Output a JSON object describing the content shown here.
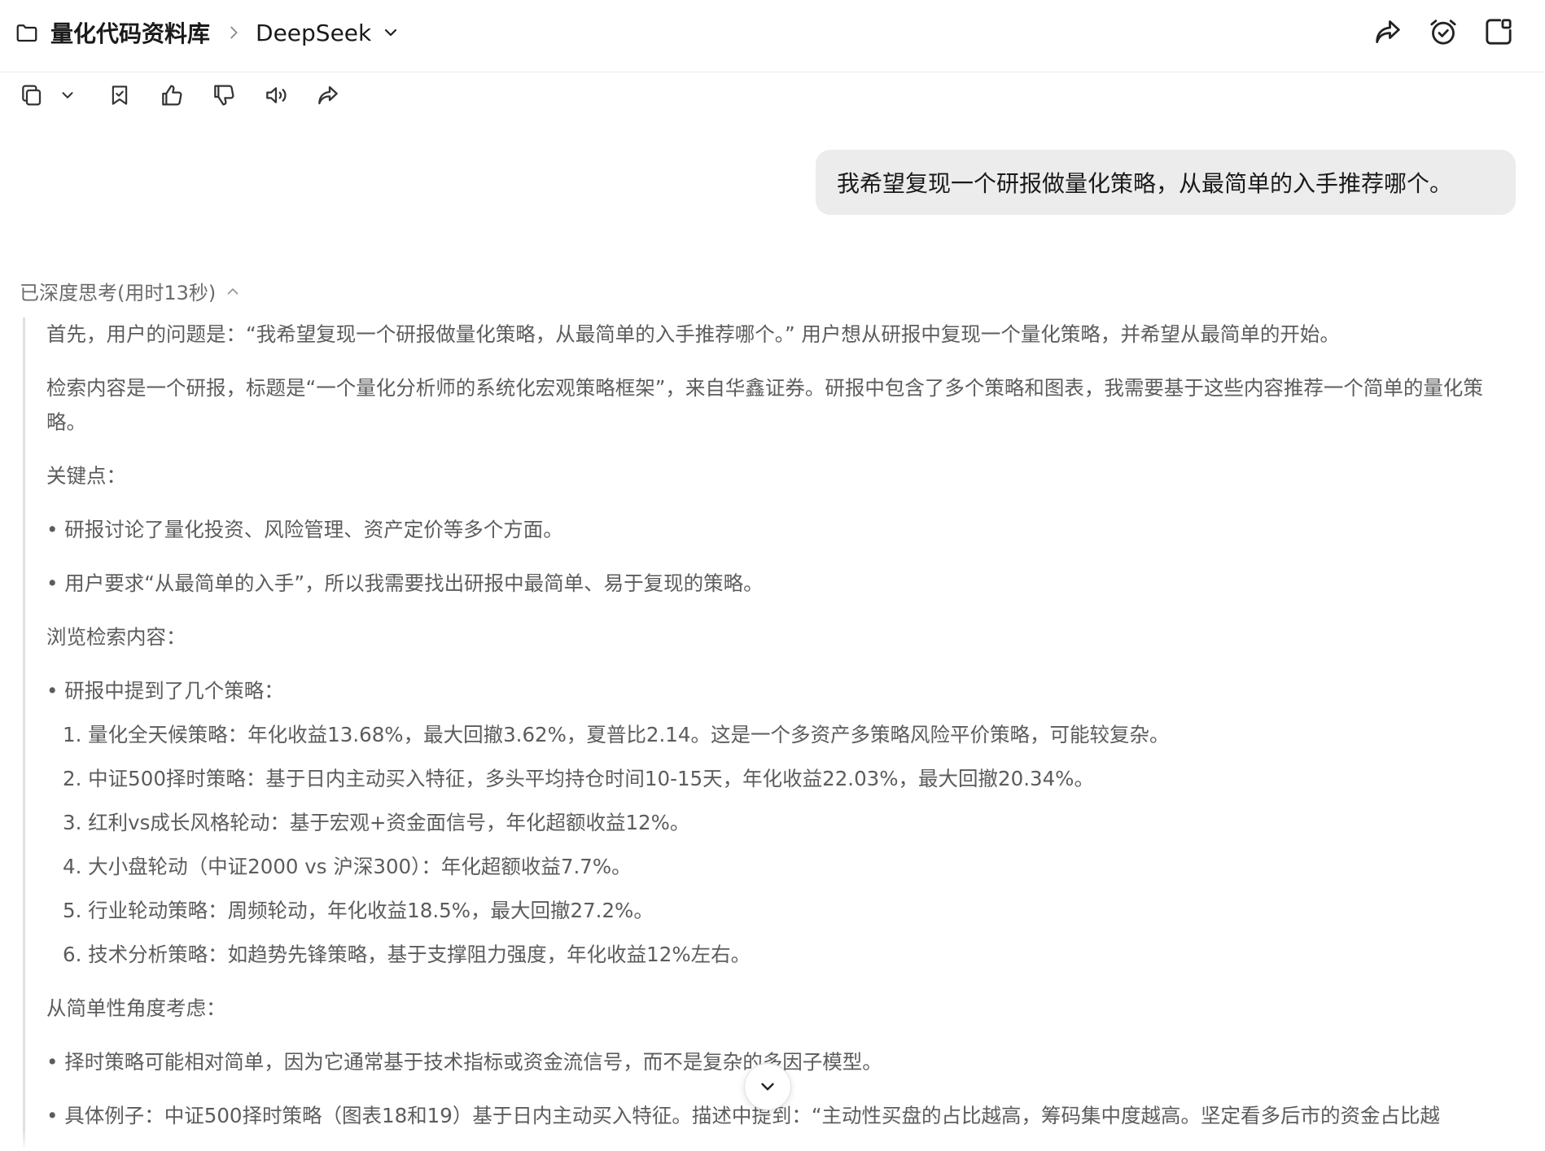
{
  "header": {
    "library": "量化代码资料库",
    "model": "DeepSeek",
    "icons": [
      "folder-icon",
      "chevron-right-icon",
      "chevron-down-icon",
      "share-icon",
      "alarm-check-icon",
      "new-window-icon"
    ]
  },
  "message_actions": {
    "icons": [
      "copy-icon",
      "chevron-down-icon",
      "bookmark-icon",
      "thumbs-up-icon",
      "thumbs-down-icon",
      "speaker-icon",
      "share-icon"
    ]
  },
  "user_message": "我希望复现一个研报做量化策略，从最简单的入手推荐哪个。",
  "thinking": {
    "header": "已深度思考(用时13秒)",
    "p1": "首先，用户的问题是：“我希望复现一个研报做量化策略，从最简单的入手推荐哪个。” 用户想从研报中复现一个量化策略，并希望从最简单的开始。",
    "p2": "检索内容是一个研报，标题是“一个量化分析师的系统化宏观策略框架”，来自华鑫证券。研报中包含了多个策略和图表，我需要基于这些内容推荐一个简单的量化策略。",
    "key_label": "关键点：",
    "key_points": [
      "• 研报讨论了量化投资、风险管理、资产定价等多个方面。",
      "• 用户要求“从最简单的入手”，所以我需要找出研报中最简单、易于复现的策略。"
    ],
    "browse_label": "浏览检索内容：",
    "browse_point": "• 研报中提到了几个策略：",
    "strategies": [
      "1. 量化全天候策略：年化收益13.68%，最大回撤3.62%，夏普比2.14。这是一个多资产多策略风险平价策略，可能较复杂。",
      "2. 中证500择时策略：基于日内主动买入特征，多头平均持仓时间10-15天，年化收益22.03%，最大回撤20.34%。",
      "3. 红利vs成长风格轮动：基于宏观+资金面信号，年化超额收益12%。",
      "4. 大小盘轮动（中证2000 vs 沪深300）：年化超额收益7.7%。",
      "5. 行业轮动策略：周频轮动，年化收益18.5%，最大回撤27.2%。",
      "6. 技术分析策略：如趋势先锋策略，基于支撑阻力强度，年化收益12%左右。"
    ],
    "simple_label": "从简单性角度考虑：",
    "simple_points": [
      "• 择时策略可能相对简单，因为它通常基于技术指标或资金流信号，而不是复杂的多因子模型。",
      "• 具体例子：中证500择时策略（图表18和19）基于日内主动买入特征。描述中提到：“主动性买盘的占比越高，筹码集中度越高。坚定看多后市的资金占比越"
    ]
  },
  "scroll_down_icon": "chevron-down-icon"
}
